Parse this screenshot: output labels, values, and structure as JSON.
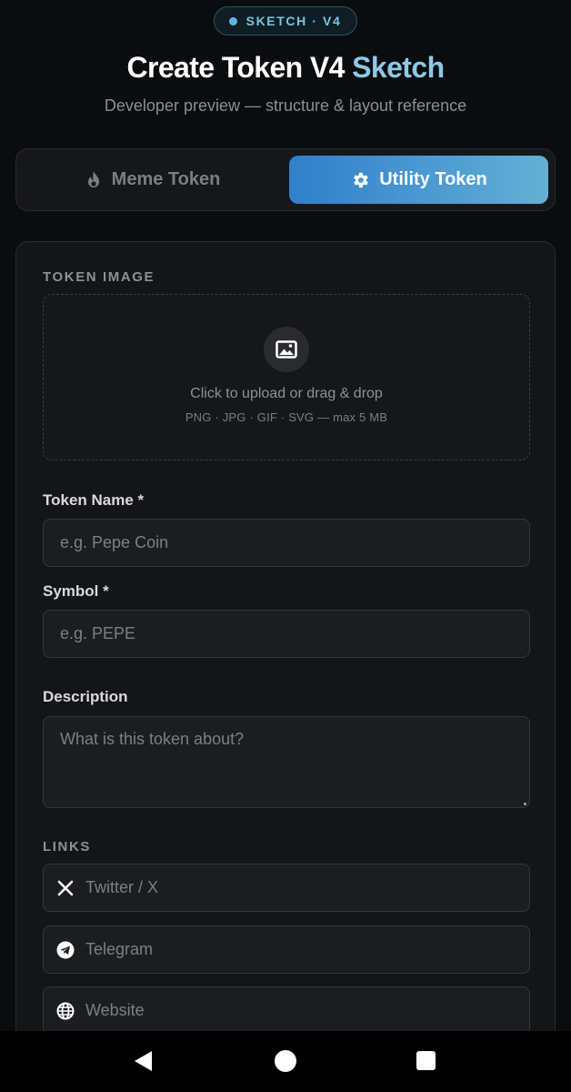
{
  "badge": {
    "text": "SKETCH · V4"
  },
  "header": {
    "title_main": "Create Token V4",
    "title_accent": "Sketch",
    "subtitle": "Developer preview — structure & layout reference"
  },
  "token_type": {
    "options": [
      {
        "label": "Meme Token",
        "icon": "flame-icon",
        "selected": false
      },
      {
        "label": "Utility Token",
        "icon": "gear-icon",
        "selected": true
      }
    ]
  },
  "form": {
    "image": {
      "section_label": "TOKEN IMAGE",
      "icon": "image-icon",
      "upload_text": "Click to upload or drag & drop",
      "upload_hint": "PNG · JPG · GIF · SVG — max 5 MB"
    },
    "name": {
      "label": "Token Name *",
      "placeholder": "e.g. Pepe Coin",
      "value": ""
    },
    "symbol": {
      "label": "Symbol *",
      "placeholder": "e.g. PEPE",
      "value": ""
    },
    "description": {
      "label": "Description",
      "placeholder": "What is this token about?",
      "value": ""
    },
    "links": {
      "section_label": "LINKS",
      "items": [
        {
          "placeholder": "Twitter / X",
          "icon": "x-logo-icon"
        },
        {
          "placeholder": "Telegram",
          "icon": "telegram-icon"
        },
        {
          "placeholder": "Website",
          "icon": "globe-icon"
        }
      ]
    }
  },
  "colors": {
    "accent_start": "#2f7fcb",
    "accent_end": "#64b0d6",
    "title_accent": "#8cc9e8",
    "background": "#0b0c0e"
  },
  "system_nav": {
    "icons": [
      "back-icon",
      "home-icon",
      "recents-icon"
    ]
  }
}
